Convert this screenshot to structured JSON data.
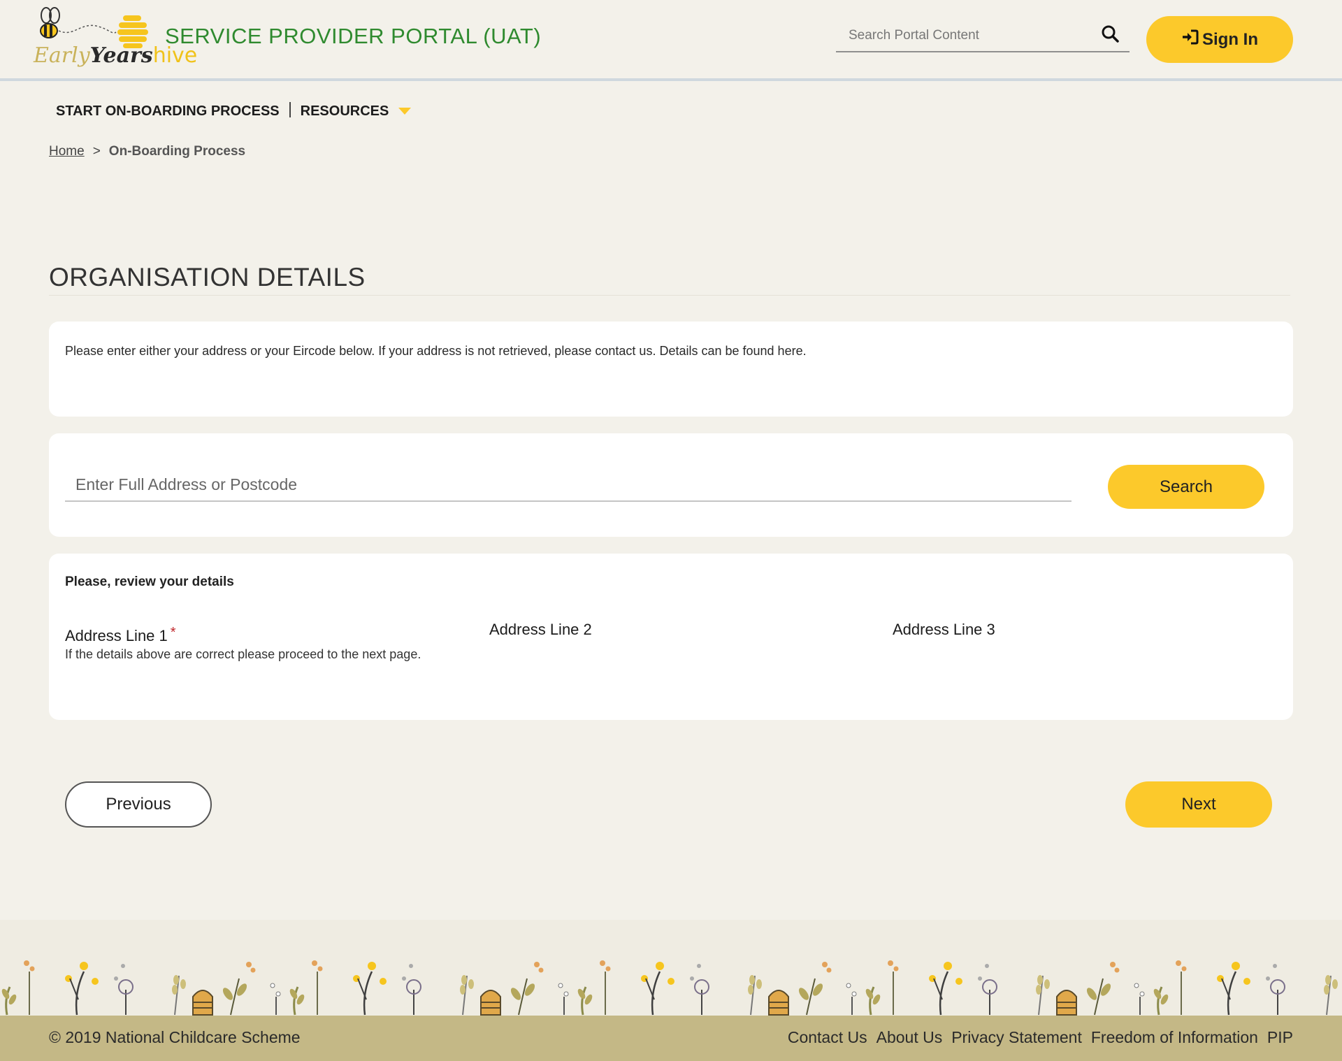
{
  "header": {
    "logo": {
      "early": "Early",
      "years": "Years",
      "hive": "hive"
    },
    "portal_title": "SERVICE PROVIDER PORTAL (UAT)",
    "search": {
      "placeholder": "Search Portal Content",
      "value": ""
    },
    "signin_label": "Sign In"
  },
  "nav": {
    "items": [
      {
        "label": "START ON-BOARDING PROCESS"
      },
      {
        "label": "RESOURCES"
      }
    ]
  },
  "breadcrumb": {
    "home": "Home",
    "separator": ">",
    "current": "On-Boarding Process"
  },
  "main": {
    "title": "ORGANISATION DETAILS",
    "info_text": "Please enter either your address or your Eircode below. If your address is not retrieved, please contact us. Details can be found here.",
    "address_search": {
      "placeholder": "Enter Full Address or Postcode",
      "value": "",
      "button_label": "Search"
    },
    "review": {
      "heading": "Please, review your details",
      "address_line_1": "Address Line 1",
      "required_mark": "*",
      "address_line_2": "Address Line 2",
      "address_line_3": "Address Line 3",
      "hint": "If the details above are correct please proceed to the next page."
    },
    "previous_label": "Previous",
    "next_label": "Next"
  },
  "footer": {
    "copyright": "© 2019 National Childcare Scheme",
    "links": [
      "Contact Us",
      "About Us",
      "Privacy Statement",
      "Freedom of Information",
      "PIP"
    ]
  },
  "colors": {
    "accent": "#fcc92b",
    "title_green": "#2f8a2f",
    "background": "#f3f1ea",
    "footer": "#c4b886",
    "required": "#c0282d"
  },
  "icons": {
    "search": "search-icon",
    "signin": "sign-in-icon",
    "dropdown": "caret-down-icon",
    "logo_bee": "bee-icon",
    "logo_hive": "hive-icon"
  }
}
